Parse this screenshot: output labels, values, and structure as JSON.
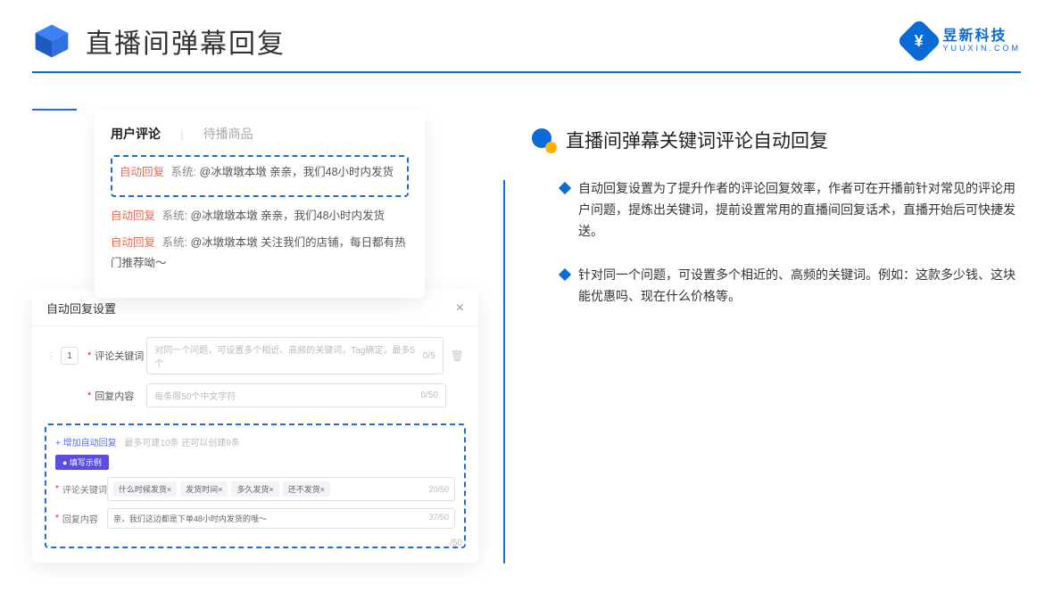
{
  "header": {
    "title": "直播间弹幕回复"
  },
  "brand": {
    "cn": "昱新科技",
    "en": "YUUXIN.COM"
  },
  "comments": {
    "tab_active": "用户评论",
    "tab_inactive": "待播商品",
    "highlight": {
      "tag_auto": "自动回复",
      "tag_sys": "系统:",
      "body": "@冰墩墩本墩 亲亲，我们48小时内发货"
    },
    "item2": {
      "tag_auto": "自动回复",
      "tag_sys": "系统:",
      "body": "@冰墩墩本墩 亲亲，我们48小时内发货"
    },
    "item3": {
      "tag_auto": "自动回复",
      "tag_sys": "系统:",
      "body": "@冰墩墩本墩 关注我们的店铺，每日都有热门推荐呦～"
    }
  },
  "settings": {
    "title": "自动回复设置",
    "num": "1",
    "kw_label": "评论关键词",
    "kw_placeholder": "对同一个问题，可设置多个相近、高频的关键词，Tag确定，最多5个",
    "kw_counter": "0/5",
    "content_label": "回复内容",
    "content_placeholder": "每条限50个中文字符",
    "content_counter": "0/50",
    "add_link": "+ 增加自动回复",
    "add_hint": "最多可建10条 还可以创建9条",
    "example_badge": "● 填写示例",
    "ex_kw_label": "评论关键词",
    "ex_chips": [
      "什么时候发货×",
      "发货时间×",
      "多久发货×",
      "还不发货×"
    ],
    "ex_kw_counter": "20/50",
    "ex_content_label": "回复内容",
    "ex_content_text": "亲，我们这边都是下单48小时内发货的哦～",
    "ex_content_counter": "37/50",
    "outer_counter": "/50"
  },
  "right": {
    "title": "直播间弹幕关键词评论自动回复",
    "bullet1": "自动回复设置为了提升作者的评论回复效率，作者可在开播前针对常见的评论用户问题，提炼出关键词，提前设置常用的直播间回复话术，直播开始后可快捷发送。",
    "bullet2": "针对同一个问题，可设置多个相近的、高频的关键词。例如：这款多少钱、这块能优惠吗、现在什么价格等。"
  }
}
